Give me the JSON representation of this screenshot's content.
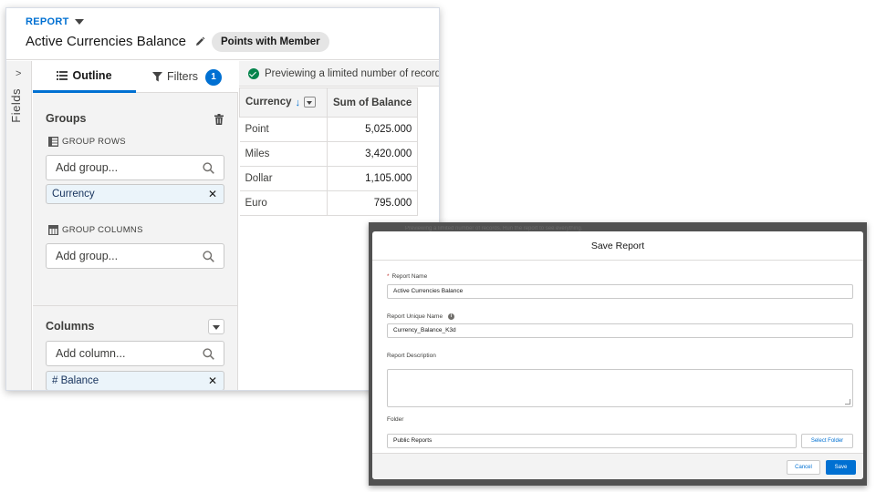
{
  "header": {
    "object_type": "REPORT",
    "title": "Active Currencies Balance",
    "report_type_pill": "Points with Member"
  },
  "fields_strip": {
    "label": "Fields",
    "chevron": ">"
  },
  "tabs": {
    "outline": "Outline",
    "filters": "Filters",
    "filters_count": "1"
  },
  "groups": {
    "title": "Groups",
    "group_rows_label": "GROUP ROWS",
    "group_rows_placeholder": "Add group...",
    "group_rows_chips": [
      "Currency"
    ],
    "group_columns_label": "GROUP COLUMNS",
    "group_columns_placeholder": "Add group..."
  },
  "columns": {
    "title": "Columns",
    "placeholder": "Add column...",
    "chips": [
      "# Balance"
    ]
  },
  "preview": {
    "notice": "Previewing a limited number of records. Run the report to see everything.",
    "headers": [
      "Currency",
      "Sum of Balance"
    ],
    "rows": [
      {
        "currency": "Point",
        "balance": "5,025.000"
      },
      {
        "currency": "Miles",
        "balance": "3,420.000"
      },
      {
        "currency": "Dollar",
        "balance": "1,105.000"
      },
      {
        "currency": "Euro",
        "balance": "795.000"
      }
    ]
  },
  "modal": {
    "peek_text": "Previewing a limited number of records. Run the report to see everything.",
    "title": "Save Report",
    "report_name_label": "Report Name",
    "report_name_value": "Active Currencies Balance",
    "unique_name_label": "Report Unique Name",
    "unique_name_value": "Currency_Balance_K3d",
    "description_label": "Report Description",
    "description_value": "",
    "folder_label": "Folder",
    "folder_value": "Public Reports",
    "select_folder_button": "Select Folder",
    "cancel_button": "Cancel",
    "save_button": "Save"
  },
  "colors": {
    "brand": "#0070d2",
    "success": "#04844b",
    "panel_bg": "#f3f3f3",
    "chip_bg": "#ebf4fa",
    "required": "#c23934"
  }
}
